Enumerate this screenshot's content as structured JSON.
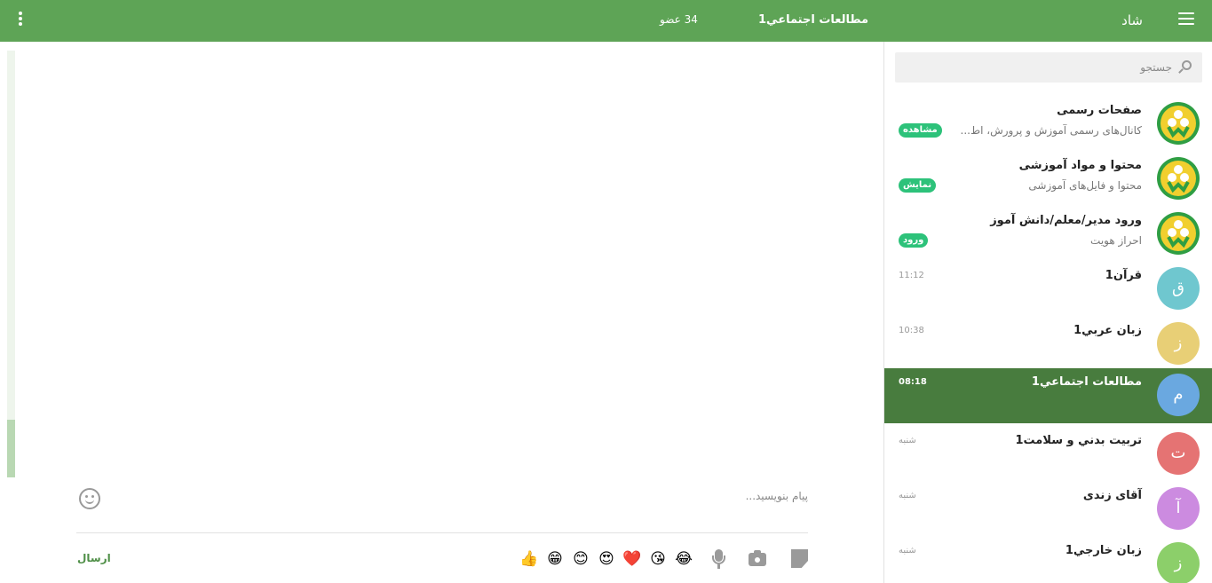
{
  "colors": {
    "header": "#5ea456",
    "active_item": "#487c3e",
    "tag": "#2dc27a",
    "send": "#4f8f47"
  },
  "header": {
    "menu_icon": "hamburger-menu-icon",
    "app_name": "شاد",
    "chat_title": "مطالعات اجتماعي1",
    "member_count": "34 عضو",
    "more_icon": "vertical-dots-icon"
  },
  "sidebar": {
    "search_placeholder": "جستجو",
    "items": [
      {
        "name": "صفحات رسمی",
        "subtitle": "کانال‌های رسمی آموزش و پرورش، اط...",
        "tag": "مشاهده",
        "avatar_type": "logo"
      },
      {
        "name": "محتوا و مواد آموزشی",
        "subtitle": "محتوا و فایل‌های آموزشی",
        "tag": "نمایش",
        "avatar_type": "logo"
      },
      {
        "name": "ورود مدیر/معلم/دانش آموز",
        "subtitle": "احراز هویت",
        "tag": "ورود",
        "avatar_type": "logo"
      },
      {
        "name": "قرآن1",
        "time": "11:12",
        "avatar_letter": "ق",
        "avatar_color": "#6fc7cf"
      },
      {
        "name": "زبان عربي1",
        "time": "10:38",
        "avatar_letter": "ز",
        "avatar_color": "#e8cf76"
      },
      {
        "name": "مطالعات اجتماعي1",
        "time": "08:18",
        "avatar_letter": "م",
        "avatar_color": "#6aa8e0",
        "active": true
      },
      {
        "name": "تربيت بدني و سلامت1",
        "time": "شنبه",
        "avatar_letter": "ت",
        "avatar_color": "#e57373"
      },
      {
        "name": "آقای زندی",
        "time": "شنبه",
        "avatar_letter": "آ",
        "avatar_color": "#cc8be0"
      },
      {
        "name": "زبان خارجي1",
        "time": "شنبه",
        "avatar_letter": "ز",
        "avatar_color": "#8ccf6a"
      }
    ]
  },
  "composer": {
    "placeholder": "پیام بنویسید...",
    "send_label": "ارسال",
    "quick_emojis": [
      "👍",
      "😁",
      "😊",
      "😍",
      "❤️",
      "😘",
      "😂"
    ],
    "tools": [
      "microphone-icon",
      "camera-icon",
      "file-icon"
    ]
  }
}
